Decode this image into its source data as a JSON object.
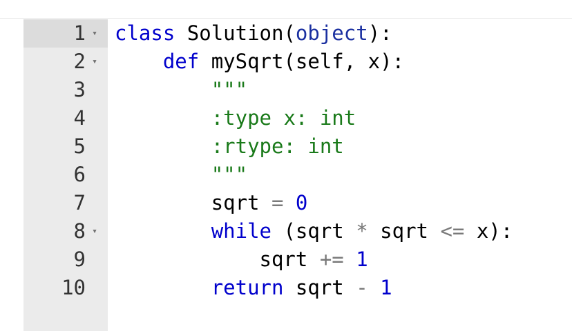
{
  "editor": {
    "lines": [
      {
        "number": "1",
        "fold": "▾",
        "tokens": [
          {
            "text": "class",
            "type": "kw"
          },
          {
            "text": " Solution(",
            "type": "plain"
          },
          {
            "text": "object",
            "type": "builtin"
          },
          {
            "text": "):",
            "type": "plain"
          }
        ]
      },
      {
        "number": "2",
        "fold": "▾",
        "tokens": [
          {
            "text": "    ",
            "type": "plain"
          },
          {
            "text": "def",
            "type": "kw"
          },
          {
            "text": " mySqrt(self, x):",
            "type": "plain"
          }
        ]
      },
      {
        "number": "3",
        "fold": "",
        "tokens": [
          {
            "text": "        ",
            "type": "plain"
          },
          {
            "text": "\"\"\"",
            "type": "str"
          }
        ]
      },
      {
        "number": "4",
        "fold": "",
        "tokens": [
          {
            "text": "        ",
            "type": "plain"
          },
          {
            "text": ":type x: int",
            "type": "str"
          }
        ]
      },
      {
        "number": "5",
        "fold": "",
        "tokens": [
          {
            "text": "        ",
            "type": "plain"
          },
          {
            "text": ":rtype: int",
            "type": "str"
          }
        ]
      },
      {
        "number": "6",
        "fold": "",
        "tokens": [
          {
            "text": "        ",
            "type": "plain"
          },
          {
            "text": "\"\"\"",
            "type": "str"
          }
        ]
      },
      {
        "number": "7",
        "fold": "",
        "tokens": [
          {
            "text": "        sqrt ",
            "type": "plain"
          },
          {
            "text": "=",
            "type": "op"
          },
          {
            "text": " ",
            "type": "plain"
          },
          {
            "text": "0",
            "type": "num"
          }
        ]
      },
      {
        "number": "8",
        "fold": "▾",
        "tokens": [
          {
            "text": "        ",
            "type": "plain"
          },
          {
            "text": "while",
            "type": "kw"
          },
          {
            "text": " (sqrt ",
            "type": "plain"
          },
          {
            "text": "*",
            "type": "op"
          },
          {
            "text": " sqrt ",
            "type": "plain"
          },
          {
            "text": "<=",
            "type": "op"
          },
          {
            "text": " x):",
            "type": "plain"
          }
        ]
      },
      {
        "number": "9",
        "fold": "",
        "tokens": [
          {
            "text": "            sqrt ",
            "type": "plain"
          },
          {
            "text": "+=",
            "type": "op"
          },
          {
            "text": " ",
            "type": "plain"
          },
          {
            "text": "1",
            "type": "num"
          }
        ]
      },
      {
        "number": "10",
        "fold": "",
        "tokens": [
          {
            "text": "        ",
            "type": "plain"
          },
          {
            "text": "return",
            "type": "kw"
          },
          {
            "text": " sqrt ",
            "type": "plain"
          },
          {
            "text": "-",
            "type": "op"
          },
          {
            "text": " ",
            "type": "plain"
          },
          {
            "text": "1",
            "type": "num"
          }
        ]
      }
    ]
  }
}
